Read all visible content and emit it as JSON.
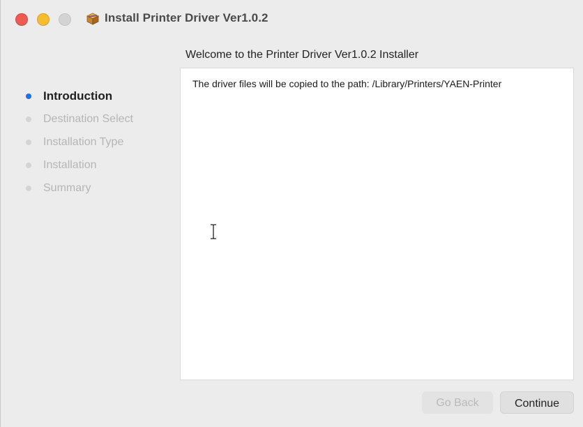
{
  "window": {
    "title": "Install Printer Driver Ver1.0.2",
    "app_icon": "package-icon"
  },
  "traffic_lights": {
    "close_color": "#ee5b52",
    "minimize_color": "#f4bd2f",
    "zoom_color": "#d3d3d3"
  },
  "content": {
    "heading": "Welcome to the Printer Driver Ver1.0.2 Installer",
    "body": "The driver files will be copied to the path: /Library/Printers/YAEN-Printer"
  },
  "steps": [
    {
      "label": "Introduction",
      "active": true
    },
    {
      "label": "Destination Select",
      "active": false
    },
    {
      "label": "Installation Type",
      "active": false
    },
    {
      "label": "Installation",
      "active": false
    },
    {
      "label": "Summary",
      "active": false
    }
  ],
  "buttons": {
    "back_label": "Go Back",
    "back_enabled": false,
    "continue_label": "Continue"
  },
  "colors": {
    "accent": "#1f6fe5"
  }
}
